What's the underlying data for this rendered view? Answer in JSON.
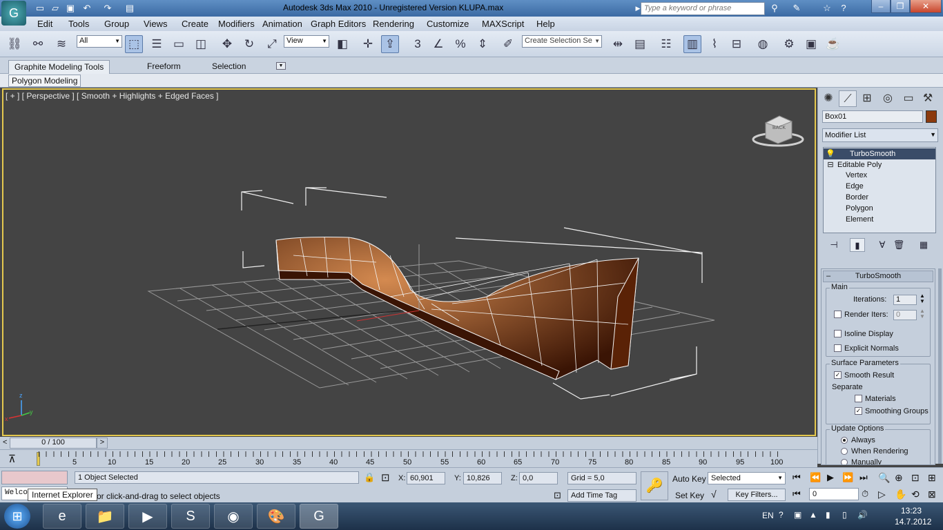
{
  "window": {
    "title": "Autodesk 3ds Max  2010  - Unregistered Version      KLUPA.max",
    "search_placeholder": "Type a keyword or phrase"
  },
  "menu": [
    "Edit",
    "Tools",
    "Group",
    "Views",
    "Create",
    "Modifiers",
    "Animation",
    "Graph Editors",
    "Rendering",
    "Customize",
    "MAXScript",
    "Help"
  ],
  "toolbar": {
    "filter_value": "All",
    "refcoord_value": "View",
    "selection_set_placeholder": "Create Selection Se",
    "snap_label": "3"
  },
  "ribbon": {
    "tabs": [
      "Graphite Modeling Tools",
      "Freeform",
      "Selection"
    ],
    "sub_label": "Polygon Modeling"
  },
  "viewport": {
    "label": "[ + ] [ Perspective ] [ Smooth + Highlights + Edged Faces ]",
    "cube_label": "BACK",
    "axis_x": "x",
    "axis_y": "y",
    "axis_z": "z"
  },
  "command_panel": {
    "object_name": "Box01",
    "object_color": "#8b3a0e",
    "modifier_list": "Modifier List",
    "stack": [
      "TurboSmooth",
      "Editable Poly",
      "Vertex",
      "Edge",
      "Border",
      "Polygon",
      "Element"
    ],
    "rollout_title": "TurboSmooth",
    "main_label": "Main",
    "iterations_label": "Iterations:",
    "iterations_value": "1",
    "render_iters_label": "Render Iters:",
    "render_iters_value": "0",
    "isoline_label": "Isoline Display",
    "explicit_label": "Explicit Normals",
    "surface_params": "Surface Parameters",
    "smooth_result": "Smooth Result",
    "separate": "Separate",
    "materials": "Materials",
    "smoothing_groups": "Smoothing Groups",
    "update_options": "Update Options",
    "always": "Always",
    "when_rendering": "When Rendering",
    "manually": "Manually"
  },
  "timeline": {
    "slider": "0 / 100",
    "ticks": [
      "5",
      "10",
      "15",
      "20",
      "25",
      "30",
      "35",
      "40",
      "45",
      "50",
      "55",
      "60",
      "65",
      "70",
      "75",
      "80",
      "85",
      "90",
      "95",
      "100"
    ]
  },
  "status": {
    "selected": "1 Object Selected",
    "prompt": "or click-and-drag to select objects",
    "welcome": "Welco",
    "x_label": "X:",
    "x_value": "60,901",
    "y_label": "Y:",
    "y_value": "10,826",
    "z_label": "Z:",
    "z_value": "0,0",
    "grid": "Grid = 5,0",
    "add_time_tag": "Add Time Tag",
    "auto_key": "Auto Key",
    "set_key": "Set Key",
    "key_mode": "Selected",
    "key_filters": "Key Filters...",
    "frame_value": "0"
  },
  "taskbar": {
    "lang": "EN",
    "time": "13:23",
    "date": "14.7.2012",
    "tooltip": "Internet Explorer"
  }
}
